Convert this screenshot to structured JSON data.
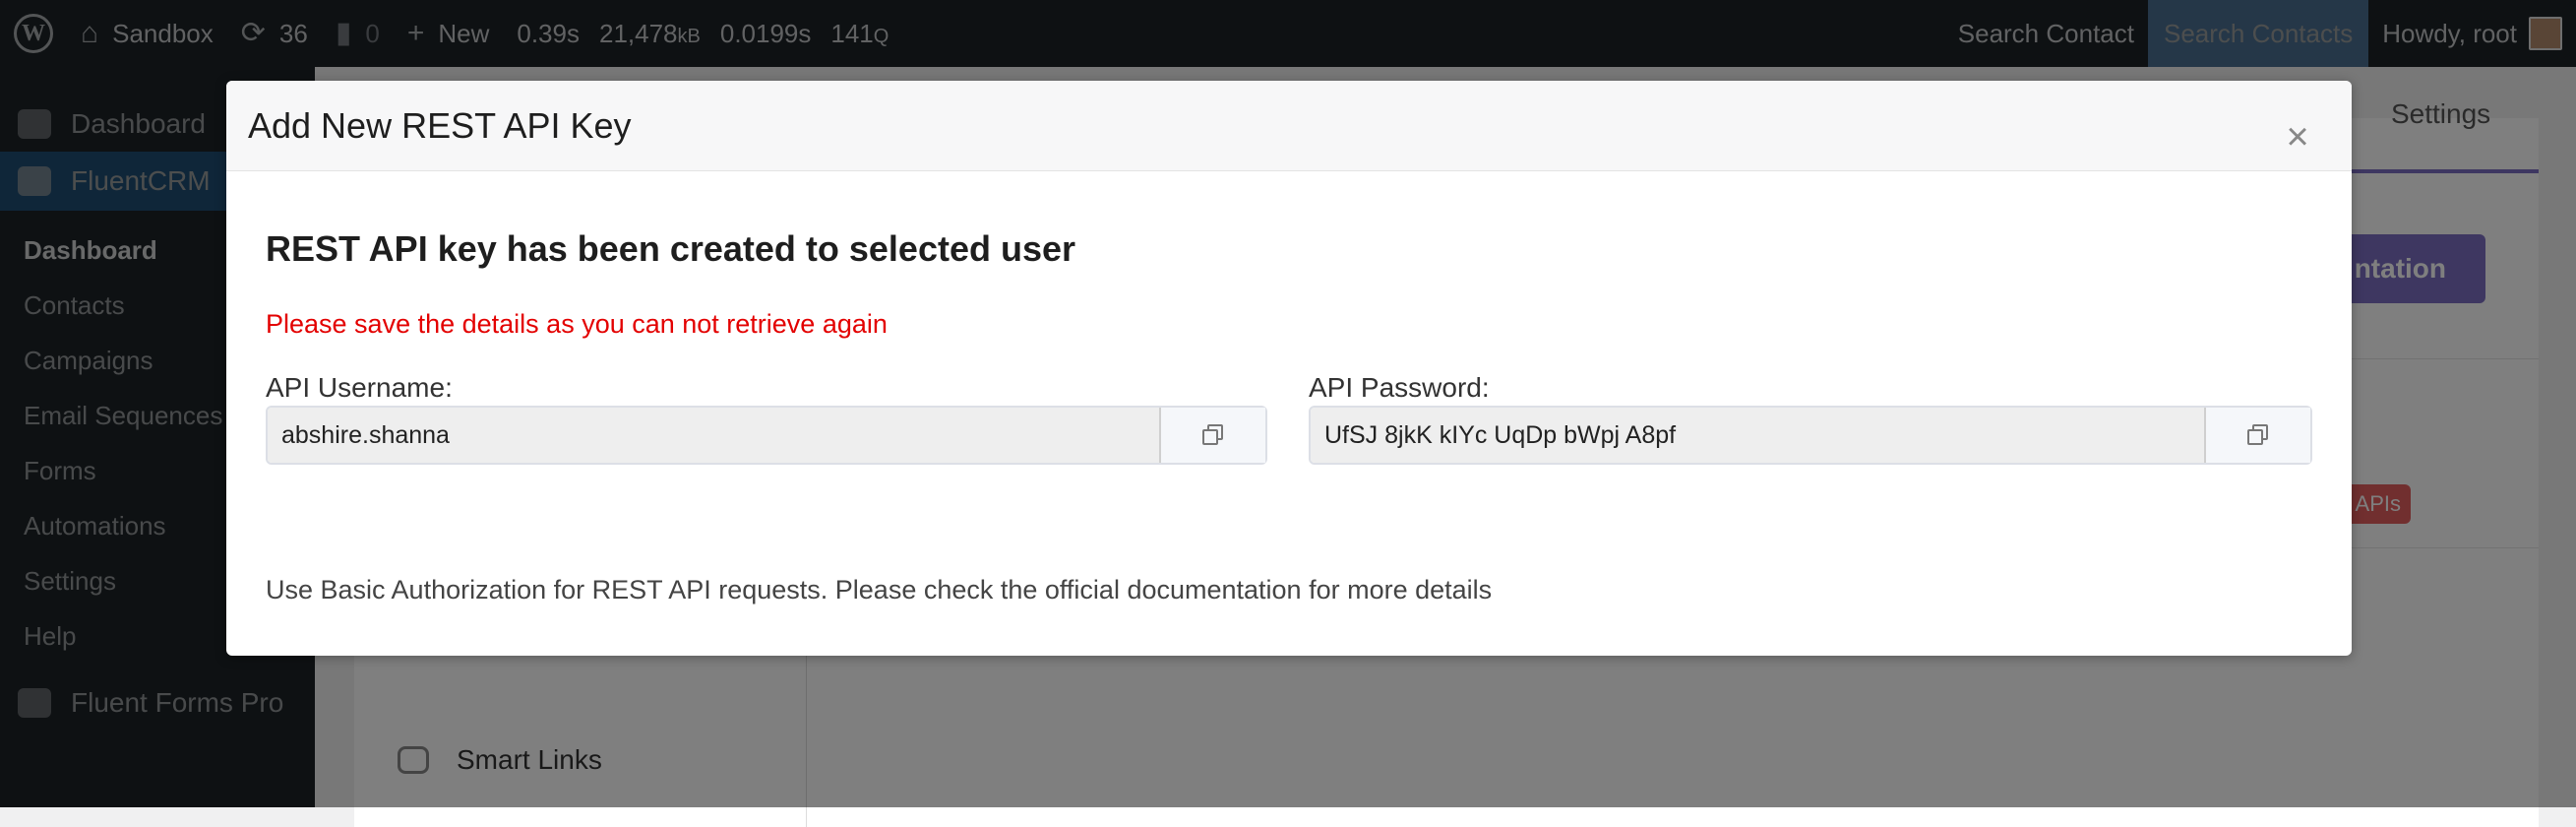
{
  "adminbar": {
    "site_name": "Sandbox",
    "updates_count": "36",
    "comments_count": "0",
    "new_label": "New",
    "query_time": "0.39s",
    "memory": "21,478",
    "memory_unit": "kB",
    "db_time": "0.0199s",
    "queries": "141",
    "queries_unit": "Q",
    "search_contact": "Search Contact",
    "search_contacts": "Search Contacts",
    "howdy": "Howdy, root"
  },
  "sidebar": {
    "dashboard": "Dashboard",
    "fluentcrm": "FluentCRM",
    "submenu": [
      "Dashboard",
      "Contacts",
      "Campaigns",
      "Email Sequences",
      "Forms",
      "Automations",
      "Settings",
      "Help"
    ],
    "fluent_forms_pro": "Fluent Forms Pro"
  },
  "background": {
    "settings_tab": "Settings",
    "documentation_button": "ntation",
    "apis_badge": "APIs",
    "smart_links": "Smart Links"
  },
  "modal": {
    "title": "Add New REST API Key",
    "close_icon": "×",
    "heading": "REST API key has been created to selected user",
    "warning": "Please save the details as you can not retrieve again",
    "username_label": "API Username:",
    "username_value": "abshire.shanna",
    "password_label": "API Password:",
    "password_value": "UfSJ 8jkK kIYc UqDp bWpj A8pf",
    "help": "Use Basic Authorization for REST API requests. Please check the official documentation for more details"
  },
  "icons": {
    "wp_logo": "wordpress-icon",
    "home": "home-icon",
    "updates": "refresh-icon",
    "comments": "comment-icon",
    "new": "plus-icon",
    "copy": "copy-icon"
  },
  "colors": {
    "accent": "#7c6fc3",
    "warning": "#e30000",
    "wp_blue": "#2271b1"
  }
}
